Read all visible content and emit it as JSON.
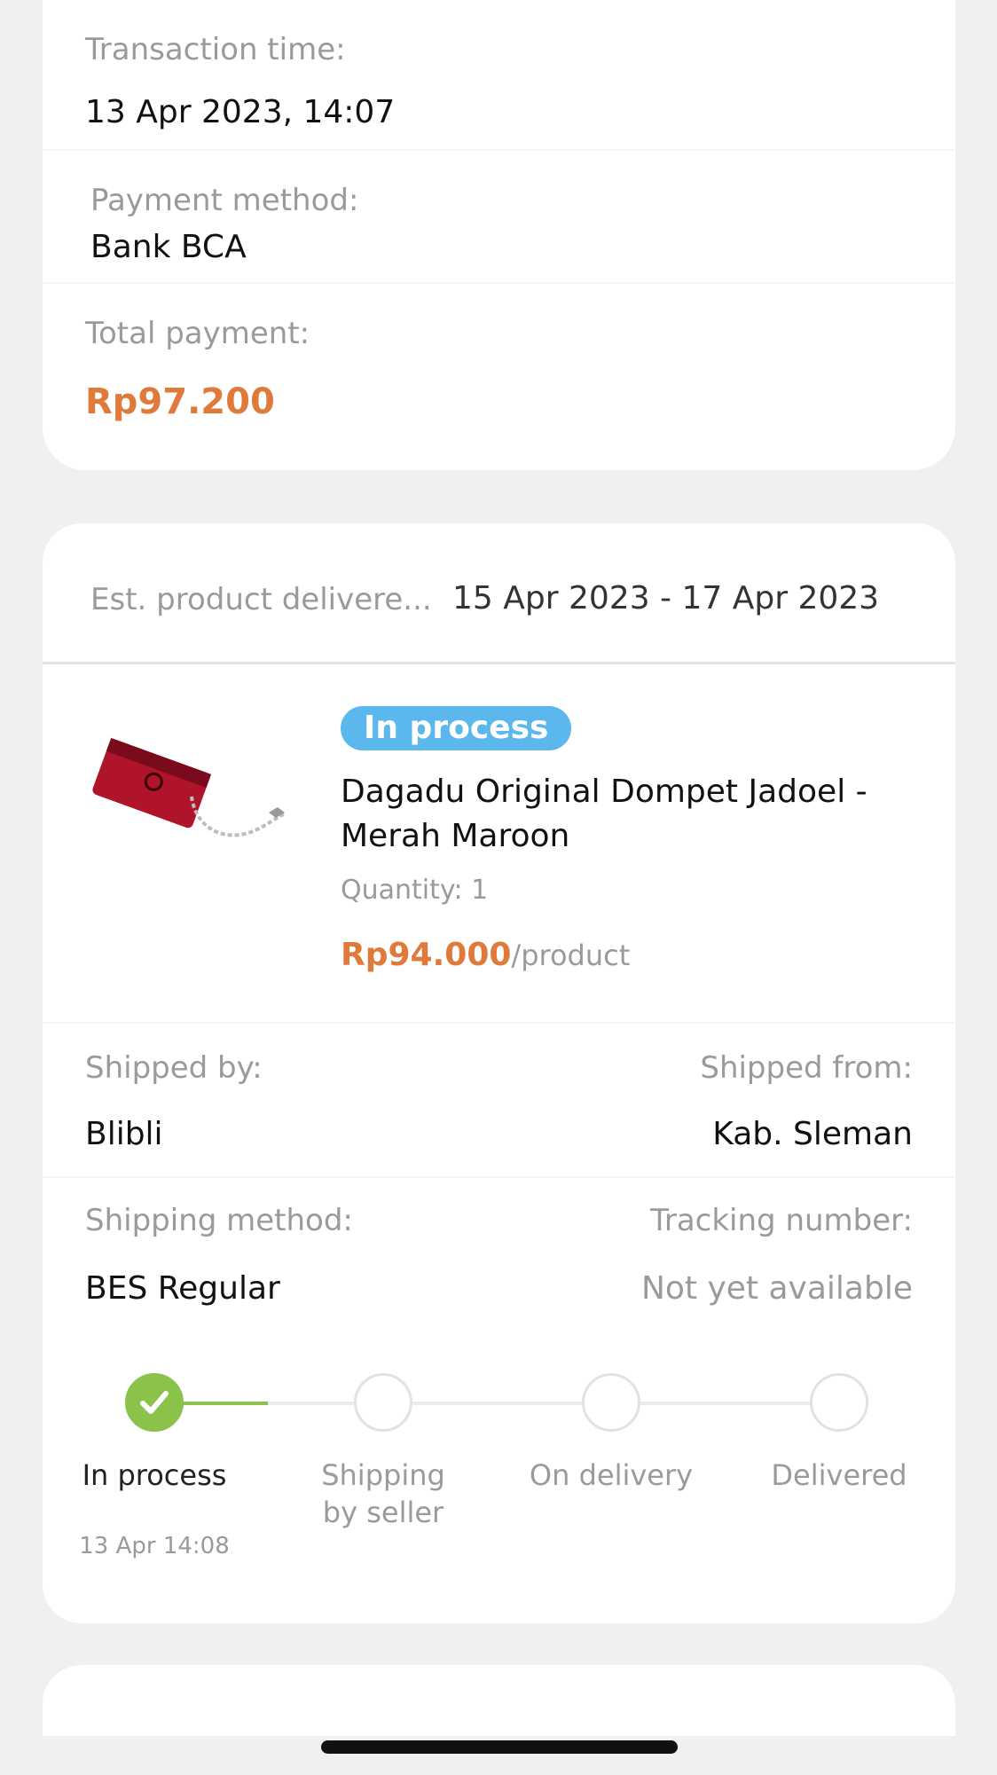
{
  "transaction": {
    "time_label": "Transaction time:",
    "time_value": "13 Apr 2023, 14:07",
    "payment_method_label": "Payment method:",
    "payment_method_value": "Bank BCA",
    "total_label": "Total payment:",
    "total_value": "Rp97.200"
  },
  "order": {
    "est_label": "Est. product delivere...",
    "est_value": "15 Apr 2023 - 17 Apr 2023",
    "status_badge": "In process",
    "product_name_line1": "Dagadu Original Dompet Jadoel -",
    "product_name_line2": "Merah Maroon",
    "quantity": "Quantity: 1",
    "price": "Rp94.000",
    "price_unit": "/product",
    "shipped_by_label": "Shipped by:",
    "shipped_by_value": "Blibli",
    "shipped_from_label": "Shipped from:",
    "shipped_from_value": "Kab. Sleman",
    "shipping_method_label": "Shipping method:",
    "shipping_method_value": "BES Regular",
    "tracking_label": "Tracking number:",
    "tracking_value": "Not yet available"
  },
  "steps": [
    {
      "label_line1": "In process",
      "label_line2": "",
      "timestamp": "13 Apr 14:08",
      "done": true
    },
    {
      "label_line1": "Shipping",
      "label_line2": "by seller",
      "timestamp": "",
      "done": false
    },
    {
      "label_line1": "On delivery",
      "label_line2": "",
      "timestamp": "",
      "done": false
    },
    {
      "label_line1": "Delivered",
      "label_line2": "",
      "timestamp": "",
      "done": false
    }
  ],
  "colors": {
    "accent_orange": "#e07a3b",
    "badge_blue": "#5cb8ec",
    "progress_green": "#8bc34a"
  },
  "icons": {
    "check": "check-icon",
    "product_image": "red-wallet-with-chain"
  }
}
